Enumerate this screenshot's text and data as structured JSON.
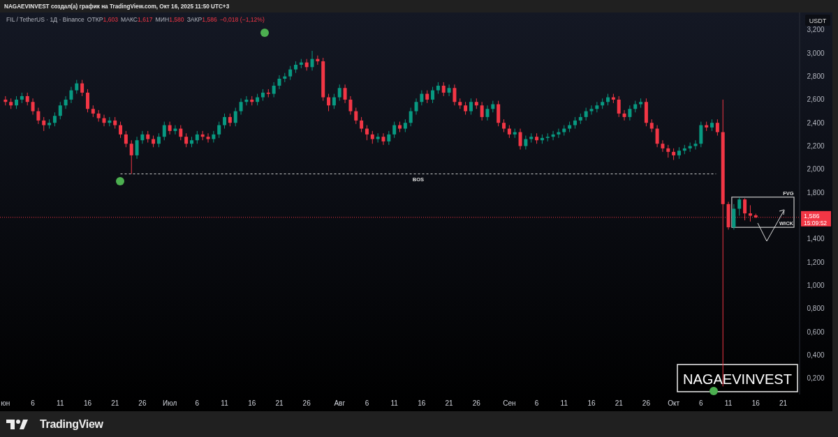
{
  "header": {
    "text": "NAGAEVINVEST создал(а) график на TradingView.com, Окт 16, 2025 11:50 UTC+3"
  },
  "legend": {
    "symbol": "FIL / TetherUS · 1Д · Binance",
    "ohlc": [
      {
        "label": "ОТКР",
        "value": "1,603"
      },
      {
        "label": "МАКС",
        "value": "1,617"
      },
      {
        "label": "МИН",
        "value": "1,580"
      },
      {
        "label": "ЗАКР",
        "value": "1,586"
      }
    ],
    "change": "−0,018 (−1,12%)"
  },
  "price_axis": {
    "currency": "USDT",
    "last_price": "1,586",
    "countdown": "15:09:52"
  },
  "chart": {
    "chart_data": {
      "type": "candlestick",
      "ylim": [
        0.06,
        3.35
      ],
      "xlim": [
        "2025-05-31",
        "2025-10-24"
      ],
      "yticks": [
        {
          "value": 3.2,
          "label": "3,200"
        },
        {
          "value": 3.0,
          "label": "3,000"
        },
        {
          "value": 2.8,
          "label": "2,800"
        },
        {
          "value": 2.6,
          "label": "2,600"
        },
        {
          "value": 2.4,
          "label": "2,400"
        },
        {
          "value": 2.2,
          "label": "2,200"
        },
        {
          "value": 2.0,
          "label": "2,000"
        },
        {
          "value": 1.8,
          "label": "1,800"
        },
        {
          "value": 1.4,
          "label": "1,400"
        },
        {
          "value": 1.2,
          "label": "1,200"
        },
        {
          "value": 1.0,
          "label": "1,000"
        },
        {
          "value": 0.8,
          "label": "0,800"
        },
        {
          "value": 0.6,
          "label": "0,600"
        },
        {
          "value": 0.4,
          "label": "0,400"
        },
        {
          "value": 0.2,
          "label": "0,200"
        }
      ],
      "xticks": [
        {
          "value": "2025-06-01",
          "label": "юн"
        },
        {
          "value": "2025-06-06",
          "label": "6"
        },
        {
          "value": "2025-06-11",
          "label": "11"
        },
        {
          "value": "2025-06-16",
          "label": "16"
        },
        {
          "value": "2025-06-21",
          "label": "21"
        },
        {
          "value": "2025-06-26",
          "label": "26"
        },
        {
          "value": "2025-07-01",
          "label": "Июл"
        },
        {
          "value": "2025-07-06",
          "label": "6"
        },
        {
          "value": "2025-07-11",
          "label": "11"
        },
        {
          "value": "2025-07-16",
          "label": "16"
        },
        {
          "value": "2025-07-21",
          "label": "21"
        },
        {
          "value": "2025-07-26",
          "label": "26"
        },
        {
          "value": "2025-08-01",
          "label": "Авг"
        },
        {
          "value": "2025-08-06",
          "label": "6"
        },
        {
          "value": "2025-08-11",
          "label": "11"
        },
        {
          "value": "2025-08-16",
          "label": "16"
        },
        {
          "value": "2025-08-21",
          "label": "21"
        },
        {
          "value": "2025-08-26",
          "label": "26"
        },
        {
          "value": "2025-09-01",
          "label": "Сен"
        },
        {
          "value": "2025-09-06",
          "label": "6"
        },
        {
          "value": "2025-09-11",
          "label": "11"
        },
        {
          "value": "2025-09-16",
          "label": "16"
        },
        {
          "value": "2025-09-21",
          "label": "21"
        },
        {
          "value": "2025-09-26",
          "label": "26"
        },
        {
          "value": "2025-10-01",
          "label": "Окт"
        },
        {
          "value": "2025-10-06",
          "label": "6"
        },
        {
          "value": "2025-10-11",
          "label": "11"
        },
        {
          "value": "2025-10-16",
          "label": "16"
        },
        {
          "value": "2025-10-21",
          "label": "21"
        }
      ],
      "ref_lines": [
        {
          "axis": "y",
          "value": 1.96,
          "label": "BOS"
        },
        {
          "axis": "y",
          "value": 1.586
        }
      ],
      "x": [
        "2025-06-01",
        "2025-06-02",
        "2025-06-03",
        "2025-06-04",
        "2025-06-05",
        "2025-06-06",
        "2025-06-07",
        "2025-06-08",
        "2025-06-09",
        "2025-06-10",
        "2025-06-11",
        "2025-06-12",
        "2025-06-13",
        "2025-06-14",
        "2025-06-15",
        "2025-06-16",
        "2025-06-17",
        "2025-06-18",
        "2025-06-19",
        "2025-06-20",
        "2025-06-21",
        "2025-06-22",
        "2025-06-23",
        "2025-06-24",
        "2025-06-25",
        "2025-06-26",
        "2025-06-27",
        "2025-06-28",
        "2025-06-29",
        "2025-06-30",
        "2025-07-01",
        "2025-07-02",
        "2025-07-03",
        "2025-07-04",
        "2025-07-05",
        "2025-07-06",
        "2025-07-07",
        "2025-07-08",
        "2025-07-09",
        "2025-07-10",
        "2025-07-11",
        "2025-07-12",
        "2025-07-13",
        "2025-07-14",
        "2025-07-15",
        "2025-07-16",
        "2025-07-17",
        "2025-07-18",
        "2025-07-19",
        "2025-07-20",
        "2025-07-21",
        "2025-07-22",
        "2025-07-23",
        "2025-07-24",
        "2025-07-25",
        "2025-07-26",
        "2025-07-27",
        "2025-07-28",
        "2025-07-29",
        "2025-07-30",
        "2025-07-31",
        "2025-08-01",
        "2025-08-02",
        "2025-08-03",
        "2025-08-04",
        "2025-08-05",
        "2025-08-06",
        "2025-08-07",
        "2025-08-08",
        "2025-08-09",
        "2025-08-10",
        "2025-08-11",
        "2025-08-12",
        "2025-08-13",
        "2025-08-14",
        "2025-08-15",
        "2025-08-16",
        "2025-08-17",
        "2025-08-18",
        "2025-08-19",
        "2025-08-20",
        "2025-08-21",
        "2025-08-22",
        "2025-08-23",
        "2025-08-24",
        "2025-08-25",
        "2025-08-26",
        "2025-08-27",
        "2025-08-28",
        "2025-08-29",
        "2025-08-30",
        "2025-08-31",
        "2025-09-01",
        "2025-09-02",
        "2025-09-03",
        "2025-09-04",
        "2025-09-05",
        "2025-09-06",
        "2025-09-07",
        "2025-09-08",
        "2025-09-09",
        "2025-09-10",
        "2025-09-11",
        "2025-09-12",
        "2025-09-13",
        "2025-09-14",
        "2025-09-15",
        "2025-09-16",
        "2025-09-17",
        "2025-09-18",
        "2025-09-19",
        "2025-09-20",
        "2025-09-21",
        "2025-09-22",
        "2025-09-23",
        "2025-09-24",
        "2025-09-25",
        "2025-09-26",
        "2025-09-27",
        "2025-09-28",
        "2025-09-29",
        "2025-09-30",
        "2025-10-01",
        "2025-10-02",
        "2025-10-03",
        "2025-10-04",
        "2025-10-05",
        "2025-10-06",
        "2025-10-07",
        "2025-10-08",
        "2025-10-09",
        "2025-10-10",
        "2025-10-11",
        "2025-10-12",
        "2025-10-13",
        "2025-10-14",
        "2025-10-15",
        "2025-10-16"
      ],
      "ohlc": [
        [
          2.6,
          2.63,
          2.55,
          2.58
        ],
        [
          2.58,
          2.61,
          2.52,
          2.55
        ],
        [
          2.55,
          2.63,
          2.52,
          2.6
        ],
        [
          2.6,
          2.66,
          2.57,
          2.63
        ],
        [
          2.63,
          2.66,
          2.55,
          2.58
        ],
        [
          2.58,
          2.61,
          2.47,
          2.5
        ],
        [
          2.5,
          2.53,
          2.39,
          2.42
        ],
        [
          2.42,
          2.45,
          2.33,
          2.38
        ],
        [
          2.38,
          2.43,
          2.35,
          2.4
        ],
        [
          2.4,
          2.49,
          2.37,
          2.46
        ],
        [
          2.46,
          2.58,
          2.43,
          2.55
        ],
        [
          2.55,
          2.63,
          2.52,
          2.6
        ],
        [
          2.6,
          2.71,
          2.57,
          2.68
        ],
        [
          2.68,
          2.77,
          2.65,
          2.74
        ],
        [
          2.74,
          2.77,
          2.63,
          2.66
        ],
        [
          2.66,
          2.69,
          2.49,
          2.52
        ],
        [
          2.52,
          2.55,
          2.45,
          2.48
        ],
        [
          2.48,
          2.51,
          2.41,
          2.44
        ],
        [
          2.44,
          2.47,
          2.37,
          2.4
        ],
        [
          2.4,
          2.45,
          2.37,
          2.42
        ],
        [
          2.42,
          2.45,
          2.35,
          2.38
        ],
        [
          2.38,
          2.41,
          2.27,
          2.3
        ],
        [
          2.3,
          2.33,
          2.19,
          2.22
        ],
        [
          2.22,
          2.25,
          1.96,
          2.12
        ],
        [
          2.12,
          2.28,
          2.09,
          2.25
        ],
        [
          2.25,
          2.33,
          2.22,
          2.3
        ],
        [
          2.3,
          2.33,
          2.23,
          2.26
        ],
        [
          2.26,
          2.29,
          2.19,
          2.22
        ],
        [
          2.22,
          2.31,
          2.19,
          2.28
        ],
        [
          2.28,
          2.41,
          2.25,
          2.38
        ],
        [
          2.38,
          2.41,
          2.3,
          2.33
        ],
        [
          2.33,
          2.38,
          2.3,
          2.35
        ],
        [
          2.35,
          2.38,
          2.25,
          2.28
        ],
        [
          2.28,
          2.31,
          2.19,
          2.22
        ],
        [
          2.22,
          2.28,
          2.19,
          2.25
        ],
        [
          2.25,
          2.33,
          2.22,
          2.3
        ],
        [
          2.3,
          2.33,
          2.25,
          2.28
        ],
        [
          2.28,
          2.31,
          2.23,
          2.26
        ],
        [
          2.26,
          2.33,
          2.23,
          2.3
        ],
        [
          2.3,
          2.41,
          2.27,
          2.38
        ],
        [
          2.38,
          2.48,
          2.35,
          2.45
        ],
        [
          2.45,
          2.48,
          2.37,
          2.4
        ],
        [
          2.4,
          2.53,
          2.37,
          2.5
        ],
        [
          2.5,
          2.61,
          2.47,
          2.58
        ],
        [
          2.58,
          2.63,
          2.55,
          2.6
        ],
        [
          2.6,
          2.63,
          2.55,
          2.58
        ],
        [
          2.58,
          2.65,
          2.55,
          2.62
        ],
        [
          2.62,
          2.69,
          2.59,
          2.66
        ],
        [
          2.66,
          2.69,
          2.62,
          2.65
        ],
        [
          2.65,
          2.75,
          2.62,
          2.72
        ],
        [
          2.72,
          2.81,
          2.69,
          2.78
        ],
        [
          2.78,
          2.83,
          2.75,
          2.8
        ],
        [
          2.8,
          2.89,
          2.77,
          2.86
        ],
        [
          2.86,
          2.93,
          2.83,
          2.9
        ],
        [
          2.9,
          2.95,
          2.87,
          2.92
        ],
        [
          2.92,
          2.95,
          2.85,
          2.88
        ],
        [
          2.88,
          3.02,
          2.85,
          2.95
        ],
        [
          2.95,
          2.98,
          2.9,
          2.93
        ],
        [
          2.93,
          2.96,
          2.59,
          2.62
        ],
        [
          2.62,
          2.65,
          2.5,
          2.55
        ],
        [
          2.55,
          2.65,
          2.52,
          2.62
        ],
        [
          2.62,
          2.73,
          2.59,
          2.7
        ],
        [
          2.7,
          2.73,
          2.57,
          2.6
        ],
        [
          2.6,
          2.63,
          2.47,
          2.5
        ],
        [
          2.5,
          2.53,
          2.39,
          2.42
        ],
        [
          2.42,
          2.45,
          2.32,
          2.35
        ],
        [
          2.35,
          2.38,
          2.25,
          2.3
        ],
        [
          2.3,
          2.33,
          2.22,
          2.26
        ],
        [
          2.26,
          2.31,
          2.23,
          2.28
        ],
        [
          2.28,
          2.31,
          2.21,
          2.24
        ],
        [
          2.24,
          2.33,
          2.21,
          2.3
        ],
        [
          2.3,
          2.41,
          2.27,
          2.38
        ],
        [
          2.38,
          2.41,
          2.32,
          2.35
        ],
        [
          2.35,
          2.43,
          2.32,
          2.4
        ],
        [
          2.4,
          2.53,
          2.37,
          2.5
        ],
        [
          2.5,
          2.61,
          2.47,
          2.58
        ],
        [
          2.58,
          2.68,
          2.55,
          2.65
        ],
        [
          2.65,
          2.68,
          2.57,
          2.6
        ],
        [
          2.6,
          2.71,
          2.57,
          2.68
        ],
        [
          2.68,
          2.75,
          2.65,
          2.72
        ],
        [
          2.72,
          2.75,
          2.63,
          2.66
        ],
        [
          2.66,
          2.73,
          2.63,
          2.7
        ],
        [
          2.7,
          2.73,
          2.55,
          2.58
        ],
        [
          2.58,
          2.61,
          2.52,
          2.55
        ],
        [
          2.55,
          2.58,
          2.47,
          2.5
        ],
        [
          2.5,
          2.61,
          2.47,
          2.58
        ],
        [
          2.58,
          2.61,
          2.52,
          2.55
        ],
        [
          2.55,
          2.58,
          2.42,
          2.45
        ],
        [
          2.45,
          2.55,
          2.42,
          2.52
        ],
        [
          2.52,
          2.59,
          2.49,
          2.56
        ],
        [
          2.56,
          2.59,
          2.37,
          2.4
        ],
        [
          2.4,
          2.43,
          2.32,
          2.35
        ],
        [
          2.35,
          2.38,
          2.27,
          2.3
        ],
        [
          2.3,
          2.35,
          2.27,
          2.32
        ],
        [
          2.32,
          2.35,
          2.17,
          2.2
        ],
        [
          2.2,
          2.29,
          2.17,
          2.26
        ],
        [
          2.26,
          2.31,
          2.23,
          2.28
        ],
        [
          2.28,
          2.31,
          2.22,
          2.25
        ],
        [
          2.25,
          2.3,
          2.22,
          2.27
        ],
        [
          2.27,
          2.31,
          2.24,
          2.28
        ],
        [
          2.28,
          2.33,
          2.25,
          2.3
        ],
        [
          2.3,
          2.35,
          2.27,
          2.32
        ],
        [
          2.32,
          2.38,
          2.29,
          2.35
        ],
        [
          2.35,
          2.41,
          2.32,
          2.38
        ],
        [
          2.38,
          2.45,
          2.35,
          2.42
        ],
        [
          2.42,
          2.48,
          2.39,
          2.45
        ],
        [
          2.45,
          2.53,
          2.42,
          2.5
        ],
        [
          2.5,
          2.55,
          2.47,
          2.52
        ],
        [
          2.52,
          2.58,
          2.49,
          2.55
        ],
        [
          2.55,
          2.61,
          2.52,
          2.58
        ],
        [
          2.58,
          2.65,
          2.55,
          2.62
        ],
        [
          2.62,
          2.65,
          2.57,
          2.6
        ],
        [
          2.6,
          2.63,
          2.45,
          2.48
        ],
        [
          2.48,
          2.51,
          2.42,
          2.45
        ],
        [
          2.45,
          2.55,
          2.42,
          2.52
        ],
        [
          2.52,
          2.59,
          2.49,
          2.56
        ],
        [
          2.56,
          2.61,
          2.53,
          2.58
        ],
        [
          2.58,
          2.61,
          2.37,
          2.4
        ],
        [
          2.4,
          2.43,
          2.32,
          2.35
        ],
        [
          2.35,
          2.38,
          2.19,
          2.22
        ],
        [
          2.22,
          2.25,
          2.15,
          2.18
        ],
        [
          2.18,
          2.21,
          2.1,
          2.15
        ],
        [
          2.15,
          2.18,
          2.08,
          2.12
        ],
        [
          2.12,
          2.19,
          2.09,
          2.16
        ],
        [
          2.16,
          2.21,
          2.13,
          2.18
        ],
        [
          2.18,
          2.23,
          2.15,
          2.2
        ],
        [
          2.2,
          2.25,
          2.17,
          2.22
        ],
        [
          2.22,
          2.41,
          2.19,
          2.38
        ],
        [
          2.38,
          2.41,
          2.33,
          2.36
        ],
        [
          2.36,
          2.43,
          2.33,
          2.4
        ],
        [
          2.4,
          2.43,
          2.29,
          2.32
        ],
        [
          2.32,
          2.6,
          0.13,
          1.7
        ],
        [
          1.7,
          1.72,
          1.48,
          1.5
        ],
        [
          1.5,
          1.7,
          1.48,
          1.66
        ],
        [
          1.66,
          1.76,
          1.6,
          1.74
        ],
        [
          1.74,
          1.75,
          1.56,
          1.62
        ],
        [
          1.62,
          1.69,
          1.55,
          1.6
        ],
        [
          1.603,
          1.617,
          1.58,
          1.586
        ]
      ]
    }
  },
  "annotations": {
    "fvg": "FVG",
    "wick": "WICK",
    "watermark": "NAGAEVINVEST"
  },
  "footer": {
    "brand": "TradingView"
  }
}
